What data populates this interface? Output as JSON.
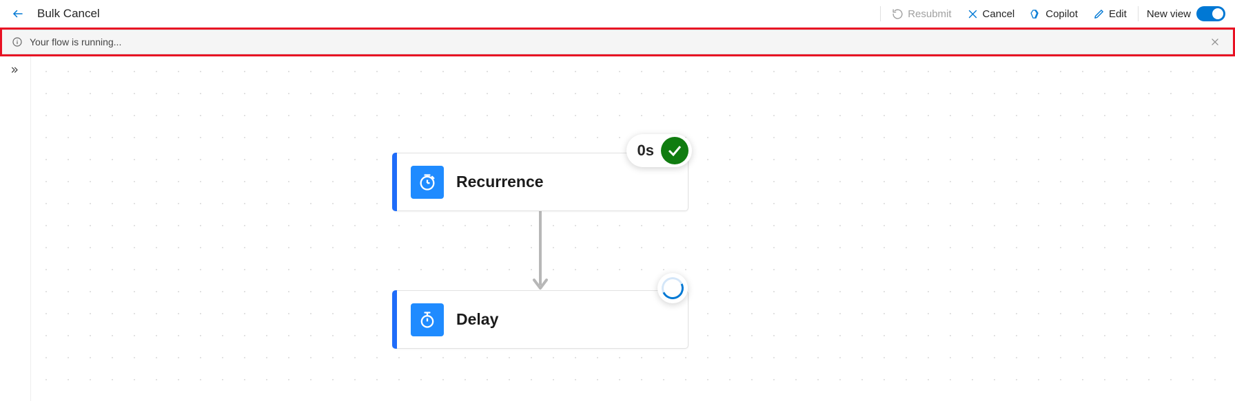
{
  "header": {
    "title": "Bulk Cancel",
    "actions": {
      "resubmit": "Resubmit",
      "cancel": "Cancel",
      "copilot": "Copilot",
      "edit": "Edit"
    },
    "toggle_label": "New view"
  },
  "notification": {
    "message": "Your flow is running..."
  },
  "flow": {
    "node1": {
      "title": "Recurrence",
      "duration": "0s"
    },
    "node2": {
      "title": "Delay"
    }
  }
}
